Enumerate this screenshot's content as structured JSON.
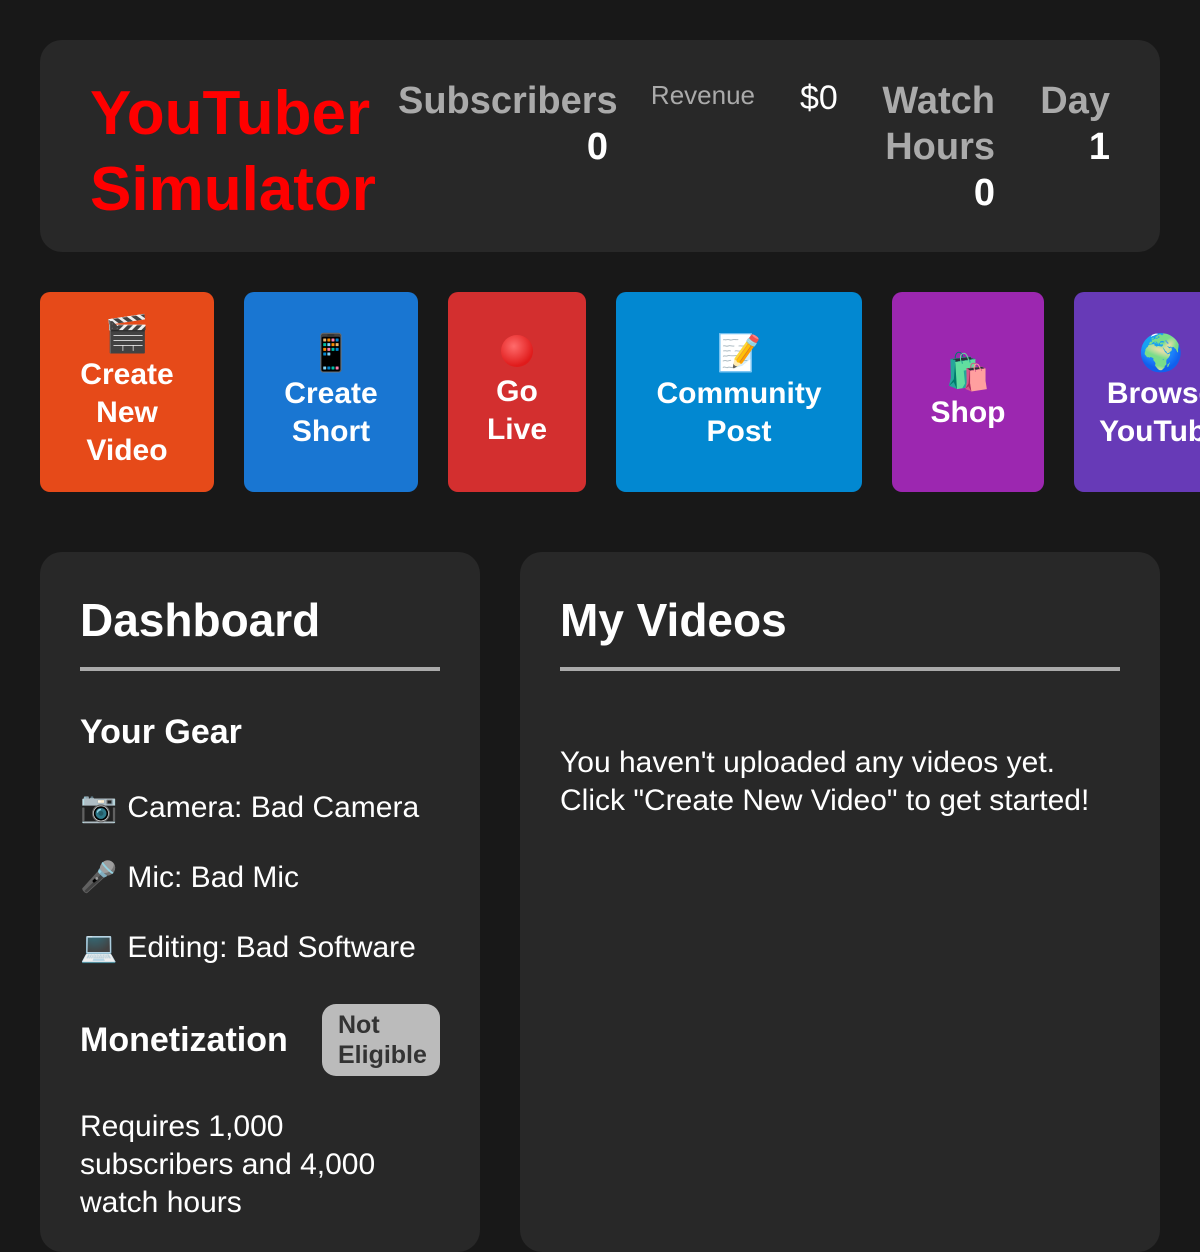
{
  "header": {
    "logo_line1": "YouTuber",
    "logo_line2": "Simulator",
    "subscribers_label": "Subscribers",
    "subscribers_value": "0",
    "revenue_label": "Revenue",
    "revenue_value": "$0",
    "watch_label_line1": "Watch",
    "watch_label_line2": "Hours",
    "watch_value": "0",
    "day_label": "Day",
    "day_value": "1"
  },
  "actions": [
    {
      "icon": "🎬",
      "icon_name": "clapperboard-icon",
      "label_lines": [
        "Create",
        "New",
        "Video"
      ],
      "color": "#e64a19"
    },
    {
      "icon": "📱",
      "icon_name": "mobile-phone-icon",
      "label_lines": [
        "Create",
        "Short"
      ],
      "color": "#1976d2"
    },
    {
      "icon": "🔴",
      "icon_name": "red-circle-icon",
      "label_lines": [
        "Go",
        "Live"
      ],
      "color": "#d32f2f"
    },
    {
      "icon": "📝",
      "icon_name": "memo-icon",
      "label_lines": [
        "Community",
        "Post"
      ],
      "color": "#0288d1"
    },
    {
      "icon": "🛍️",
      "icon_name": "shopping-bags-icon",
      "label_lines": [
        "Shop"
      ],
      "color": "#9c27b0"
    },
    {
      "icon": "🌍",
      "icon_name": "globe-icon",
      "label_lines": [
        "Browse",
        "YouTube"
      ],
      "color": "#673ab7"
    }
  ],
  "dashboard": {
    "title": "Dashboard",
    "gear_title": "Your Gear",
    "camera_icon": "📷",
    "camera": "Camera: Bad Camera",
    "mic_icon": "🎤",
    "mic": "Mic: Bad Mic",
    "editing_icon": "💻",
    "editing": "Editing: Bad Software",
    "monetization_title": "Monetization",
    "monetization_status_line1": "Not",
    "monetization_status_line2": "Eligible",
    "monetization_requirement": "Requires 1,000 subscribers and 4,000 watch hours"
  },
  "videos": {
    "title": "My Videos",
    "empty_line1": "You haven't uploaded any videos yet.",
    "empty_line2": "Click \"Create New Video\" to get started!"
  },
  "colors": {
    "background": "#181818",
    "panel": "#282828",
    "brand_red": "#ff0000",
    "muted_label": "#aaaaaa",
    "badge_bg": "#bbbbbb"
  }
}
